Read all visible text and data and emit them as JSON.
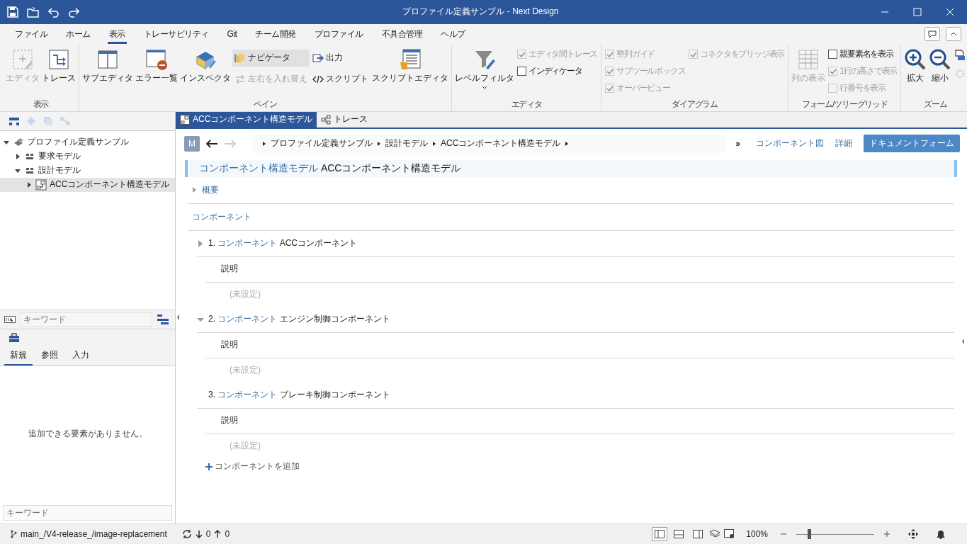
{
  "window": {
    "title": "プロファイル定義サンプル - Next Design"
  },
  "menu": [
    {
      "label": "ファイル",
      "selected": false
    },
    {
      "label": "ホーム",
      "selected": false
    },
    {
      "label": "表示",
      "selected": true
    },
    {
      "label": "トレーサビリティ",
      "selected": false
    },
    {
      "label": "Git",
      "selected": false
    },
    {
      "label": "チーム開発",
      "selected": false
    },
    {
      "label": "プロファイル",
      "selected": false
    },
    {
      "label": "不具合管理",
      "selected": false
    },
    {
      "label": "ヘルプ",
      "selected": false
    }
  ],
  "ribbon": [
    {
      "label": "表示",
      "columns": [
        [
          {
            "kind": "large",
            "label": "エディタ",
            "disabled": true
          }
        ],
        [
          {
            "kind": "large",
            "label": "トレース",
            "disabled": false
          }
        ]
      ]
    },
    {
      "label": "ペイン",
      "columns": [
        [
          {
            "kind": "large",
            "label": "サブエディタ",
            "disabled": false
          }
        ],
        [
          {
            "kind": "large",
            "label": "エラー一覧",
            "disabled": false
          }
        ],
        [
          {
            "kind": "large",
            "label": "インスペクタ",
            "disabled": false
          }
        ],
        [
          {
            "kind": "small",
            "label": "ナビゲータ",
            "disabled": false,
            "selected": true
          },
          {
            "kind": "small",
            "label": "左右を入れ替え",
            "disabled": true,
            "selected": false
          }
        ],
        [
          {
            "kind": "small",
            "label": "出力",
            "disabled": false,
            "selected": false
          },
          {
            "kind": "small",
            "label": "スクリプト",
            "disabled": false,
            "selected": false
          }
        ],
        [
          {
            "kind": "large",
            "label": "スクリプトエディタ",
            "disabled": false
          }
        ]
      ]
    },
    {
      "label": "エディタ",
      "columns": [
        [
          {
            "kind": "large",
            "label": "レベルフィルタ",
            "disabled": false,
            "dropdown": true
          }
        ],
        [
          {
            "kind": "check",
            "label": "エディタ間トレース",
            "checked": true,
            "disabled": true
          },
          {
            "kind": "check",
            "label": "インディケータ",
            "checked": false,
            "disabled": false
          }
        ]
      ]
    },
    {
      "label": "ダイアグラム",
      "columns": [
        [
          {
            "kind": "check",
            "label": "整列ガイド",
            "checked": true,
            "disabled": true
          },
          {
            "kind": "check",
            "label": "サブツールボックス",
            "checked": true,
            "disabled": true
          },
          {
            "kind": "check",
            "label": "オーバービュー",
            "checked": true,
            "disabled": true
          }
        ],
        [
          {
            "kind": "check",
            "label": "コネクタをブリッジ表示",
            "checked": true,
            "disabled": true
          }
        ]
      ]
    },
    {
      "label": "フォーム/ツリーグリッド",
      "columns": [
        [
          {
            "kind": "large",
            "label": "列の表示",
            "disabled": true
          }
        ],
        [
          {
            "kind": "check",
            "label": "親要素名を表示",
            "checked": false,
            "disabled": false
          },
          {
            "kind": "check",
            "label": "1行の高さで表示",
            "checked": true,
            "disabled": true
          },
          {
            "kind": "check",
            "label": "行番号を表示",
            "checked": false,
            "disabled": true
          }
        ]
      ]
    },
    {
      "label": "ズーム",
      "columns": [
        [
          {
            "kind": "large",
            "label": "拡大",
            "disabled": false
          }
        ],
        [
          {
            "kind": "large",
            "label": "縮小",
            "disabled": false
          }
        ],
        [
          {
            "kind": "icon",
            "disabled": false
          },
          {
            "kind": "icon",
            "disabled": true
          }
        ]
      ]
    }
  ],
  "tree": [
    {
      "label": "プロファイル定義サンプル",
      "kind": "project",
      "expanded": true,
      "selected": false,
      "children": [
        {
          "label": "要求モデル",
          "kind": "package",
          "expanded": false,
          "selected": false
        },
        {
          "label": "設計モデル",
          "kind": "package",
          "expanded": true,
          "selected": false,
          "children": [
            {
              "label": "ACCコンポーネント構造モデル",
              "kind": "model",
              "expanded": false,
              "selected": true
            }
          ]
        }
      ]
    }
  ],
  "search": {
    "placeholder": "キーワード"
  },
  "toolbox": {
    "tabs": [
      {
        "label": "新規",
        "selected": true
      },
      {
        "label": "参照",
        "selected": false
      },
      {
        "label": "入力",
        "selected": false
      }
    ],
    "message": "追加できる要素がありません。",
    "search": {
      "placeholder": "キーワード"
    }
  },
  "doc_tabs": [
    {
      "label": "ACCコンポーネント構造モデル",
      "selected": true
    },
    {
      "label": "トレース",
      "selected": false
    }
  ],
  "badge": "M",
  "breadcrumb": [
    "プロファイル定義サンプル",
    "設計モデル",
    "ACCコンポーネント構造モデル"
  ],
  "more": "»",
  "views": [
    {
      "label": "コンポーネント図",
      "selected": false
    },
    {
      "label": "詳細",
      "selected": false
    },
    {
      "label": "ドキュメントフォーム",
      "selected": true
    }
  ],
  "heading": {
    "type": "コンポーネント構造モデル",
    "name": "ACCコンポーネント構造モデル"
  },
  "overview": {
    "label": "概要",
    "expanded": false
  },
  "components": {
    "label": "コンポーネント",
    "items": [
      {
        "number": "1.",
        "type": "コンポーネント",
        "name": "ACCコンポーネント",
        "expanded": false,
        "fields": [
          {
            "label": "説明",
            "value": "(未設定)"
          }
        ]
      },
      {
        "number": "2.",
        "type": "コンポーネント",
        "name": "エンジン制御コンポーネント",
        "expanded": true,
        "fields": [
          {
            "label": "説明",
            "value": "(未設定)"
          }
        ]
      },
      {
        "number": "3.",
        "type": "コンポーネント",
        "name": "ブレーキ制御コンポーネント",
        "fields": [
          {
            "label": "説明",
            "value": "(未設定)"
          }
        ]
      }
    ],
    "add": "コンポーネントを追加"
  },
  "status_bar": {
    "branch": "main_/V4-release_/image-replacement",
    "incoming": "0",
    "outgoing": "0",
    "layouts": [
      {
        "selected": true
      },
      {
        "selected": false
      },
      {
        "selected": false
      }
    ],
    "zoom": "100%",
    "zoom_slider": {
      "level": 0.16
    }
  }
}
